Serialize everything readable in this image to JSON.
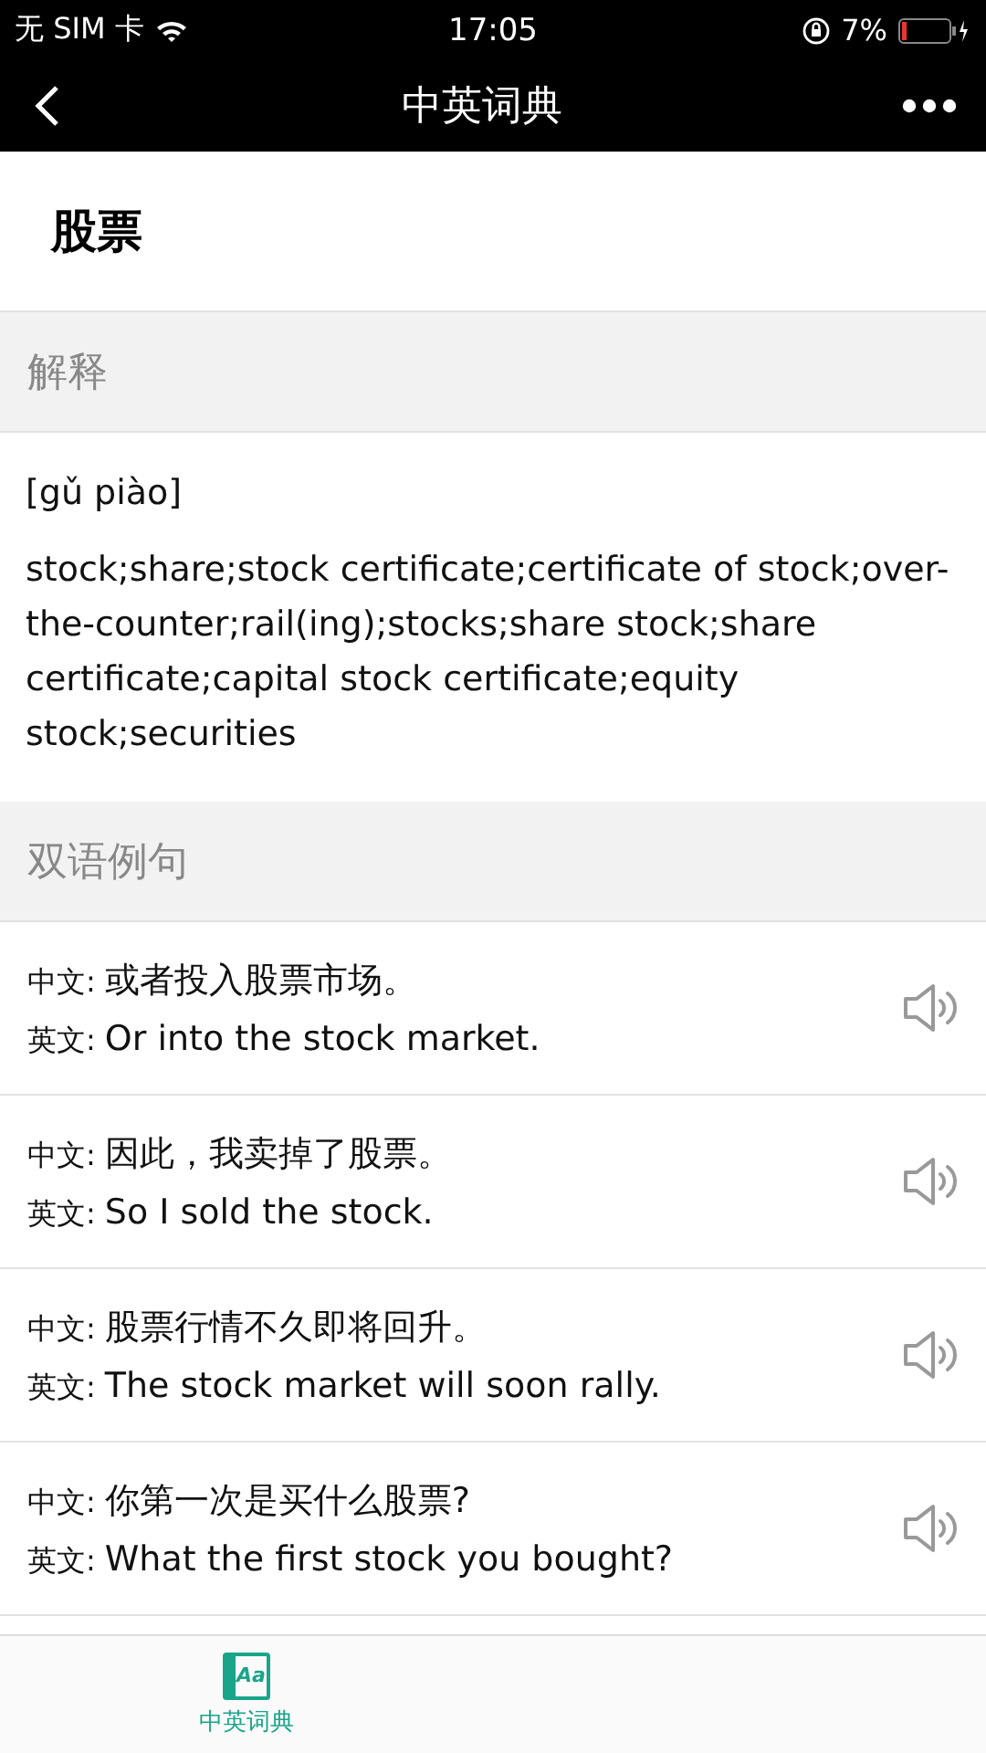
{
  "status_bar": {
    "carrier": "无 SIM 卡",
    "time": "17:05",
    "battery": "7%"
  },
  "nav_bar": {
    "title": "中英词典"
  },
  "word": "股票",
  "sections": [
    {
      "kind": "definition",
      "title": "解释",
      "pinyin": "[gǔ piào]",
      "definition": "stock;share;stock certificate;certificate of stock;over-the-counter;rail(ing);stocks;share stock;share certificate;capital stock certificate;equity stock;securities"
    },
    {
      "kind": "examples",
      "title": "双语例句",
      "examples": [
        {
          "zh_label": "中文:",
          "zh": "或者投入股票市场。",
          "en_label": "英文:",
          "en": "Or into the stock market."
        },
        {
          "zh_label": "中文:",
          "zh": "因此，我卖掉了股票。",
          "en_label": "英文:",
          "en": "So I sold the stock."
        },
        {
          "zh_label": "中文:",
          "zh": "股票行情不久即将回升。",
          "en_label": "英文:",
          "en": "The stock market will soon rally."
        },
        {
          "zh_label": "中文:",
          "zh": "你第一次是买什么股票?",
          "en_label": "英文:",
          "en": "What the first stock you bought?"
        }
      ]
    }
  ],
  "tab_bar": [
    {
      "label": "中英词典",
      "icon_text": "Aa",
      "selected": true
    }
  ]
}
